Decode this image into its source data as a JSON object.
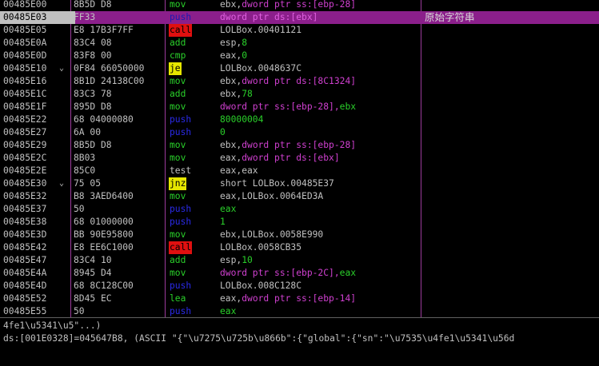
{
  "disassembly": {
    "rows": [
      {
        "addr": "00485E00",
        "mark": "",
        "hex": "8B5D D8",
        "mn": "mov",
        "kind": "mov",
        "ops": [
          [
            "ebx,",
            "plain"
          ],
          [
            "dword ptr ss:[ebp-28]",
            "mem"
          ]
        ],
        "comment": ""
      },
      {
        "addr": "00485E03",
        "mark": "",
        "hex": "FF33",
        "mn": "push",
        "kind": "push",
        "ops": [
          [
            "dword ptr ds:[ebx]",
            "mem"
          ]
        ],
        "comment": "原始字符串",
        "selected": true
      },
      {
        "addr": "00485E05",
        "mark": "",
        "hex": "E8 17B3F7FF",
        "mn": "call",
        "kind": "call",
        "ops": [
          [
            "LOLBox.00401121",
            "plain"
          ]
        ],
        "comment": ""
      },
      {
        "addr": "00485E0A",
        "mark": "",
        "hex": "83C4 08",
        "mn": "add",
        "kind": "mov",
        "ops": [
          [
            "esp,",
            "plain"
          ],
          [
            "8",
            "num"
          ]
        ],
        "comment": ""
      },
      {
        "addr": "00485E0D",
        "mark": "",
        "hex": "83F8 00",
        "mn": "cmp",
        "kind": "mov",
        "ops": [
          [
            "eax,",
            "plain"
          ],
          [
            "0",
            "num"
          ]
        ],
        "comment": ""
      },
      {
        "addr": "00485E10",
        "mark": "⌄",
        "hex": "0F84 66050000",
        "mn": "je",
        "kind": "jmp",
        "ops": [
          [
            "LOLBox.0048637C",
            "plain"
          ]
        ],
        "comment": ""
      },
      {
        "addr": "00485E16",
        "mark": "",
        "hex": "8B1D 24138C00",
        "mn": "mov",
        "kind": "mov",
        "ops": [
          [
            "ebx,",
            "plain"
          ],
          [
            "dword ptr ds:[8C1324]",
            "mem"
          ]
        ],
        "comment": ""
      },
      {
        "addr": "00485E1C",
        "mark": "",
        "hex": "83C3 78",
        "mn": "add",
        "kind": "mov",
        "ops": [
          [
            "ebx,",
            "plain"
          ],
          [
            "78",
            "num"
          ]
        ],
        "comment": ""
      },
      {
        "addr": "00485E1F",
        "mark": "",
        "hex": "895D D8",
        "mn": "mov",
        "kind": "mov",
        "ops": [
          [
            "dword ptr ss:[ebp-28],",
            "mem"
          ],
          [
            "ebx",
            "reg"
          ]
        ],
        "comment": ""
      },
      {
        "addr": "00485E22",
        "mark": "",
        "hex": "68 04000080",
        "mn": "push",
        "kind": "push",
        "ops": [
          [
            "80000004",
            "num"
          ]
        ],
        "comment": ""
      },
      {
        "addr": "00485E27",
        "mark": "",
        "hex": "6A 00",
        "mn": "push",
        "kind": "push",
        "ops": [
          [
            "0",
            "num"
          ]
        ],
        "comment": ""
      },
      {
        "addr": "00485E29",
        "mark": "",
        "hex": "8B5D D8",
        "mn": "mov",
        "kind": "mov",
        "ops": [
          [
            "ebx,",
            "plain"
          ],
          [
            "dword ptr ss:[ebp-28]",
            "mem"
          ]
        ],
        "comment": ""
      },
      {
        "addr": "00485E2C",
        "mark": "",
        "hex": "8B03",
        "mn": "mov",
        "kind": "mov",
        "ops": [
          [
            "eax,",
            "plain"
          ],
          [
            "dword ptr ds:[ebx]",
            "mem"
          ]
        ],
        "comment": ""
      },
      {
        "addr": "00485E2E",
        "mark": "",
        "hex": "85C0",
        "mn": "test",
        "kind": "test",
        "ops": [
          [
            "eax,eax",
            "plain"
          ]
        ],
        "comment": ""
      },
      {
        "addr": "00485E30",
        "mark": "⌄",
        "hex": "75 05",
        "mn": "jnz",
        "kind": "jmp",
        "ops": [
          [
            "short LOLBox.00485E37",
            "plain"
          ]
        ],
        "comment": ""
      },
      {
        "addr": "00485E32",
        "mark": "",
        "hex": "B8 3AED6400",
        "mn": "mov",
        "kind": "mov",
        "ops": [
          [
            "eax,LOLBox.0064ED3A",
            "plain"
          ]
        ],
        "comment": ""
      },
      {
        "addr": "00485E37",
        "mark": "",
        "hex": "50",
        "mn": "push",
        "kind": "push",
        "ops": [
          [
            "eax",
            "reg"
          ]
        ],
        "comment": ""
      },
      {
        "addr": "00485E38",
        "mark": "",
        "hex": "68 01000000",
        "mn": "push",
        "kind": "push",
        "ops": [
          [
            "1",
            "num"
          ]
        ],
        "comment": ""
      },
      {
        "addr": "00485E3D",
        "mark": "",
        "hex": "BB 90E95800",
        "mn": "mov",
        "kind": "mov",
        "ops": [
          [
            "ebx,LOLBox.0058E990",
            "plain"
          ]
        ],
        "comment": ""
      },
      {
        "addr": "00485E42",
        "mark": "",
        "hex": "E8 EE6C1000",
        "mn": "call",
        "kind": "call",
        "ops": [
          [
            "LOLBox.0058CB35",
            "plain"
          ]
        ],
        "comment": ""
      },
      {
        "addr": "00485E47",
        "mark": "",
        "hex": "83C4 10",
        "mn": "add",
        "kind": "mov",
        "ops": [
          [
            "esp,",
            "plain"
          ],
          [
            "10",
            "num"
          ]
        ],
        "comment": ""
      },
      {
        "addr": "00485E4A",
        "mark": "",
        "hex": "8945 D4",
        "mn": "mov",
        "kind": "mov",
        "ops": [
          [
            "dword ptr ss:[ebp-2C],",
            "mem"
          ],
          [
            "eax",
            "reg"
          ]
        ],
        "comment": ""
      },
      {
        "addr": "00485E4D",
        "mark": "",
        "hex": "68 8C128C00",
        "mn": "push",
        "kind": "push",
        "ops": [
          [
            "LOLBox.008C128C",
            "plain"
          ]
        ],
        "comment": ""
      },
      {
        "addr": "00485E52",
        "mark": "",
        "hex": "8D45 EC",
        "mn": "lea",
        "kind": "mov",
        "ops": [
          [
            "eax,",
            "plain"
          ],
          [
            "dword ptr ss:[ebp-14]",
            "mem"
          ]
        ],
        "comment": ""
      },
      {
        "addr": "00485E55",
        "mark": "",
        "hex": "50",
        "mn": "push",
        "kind": "push",
        "ops": [
          [
            "eax",
            "reg"
          ]
        ],
        "comment": ""
      }
    ]
  },
  "info_pane": {
    "line1": "4fe1\\u5341\\u5\"...)",
    "line2": "ds:[001E0328]=045647B8, (ASCII \"{\"\\u7275\\u725b\\u866b\":{\"global\":{\"sn\":\"\\u7535\\u4fe1\\u5341\\u56d"
  },
  "colors": {
    "background": "#000000",
    "selection": "#8b1f8b",
    "separator": "#9c3b9c",
    "call_bg": "#e01010",
    "jump_bg": "#e6e600"
  }
}
